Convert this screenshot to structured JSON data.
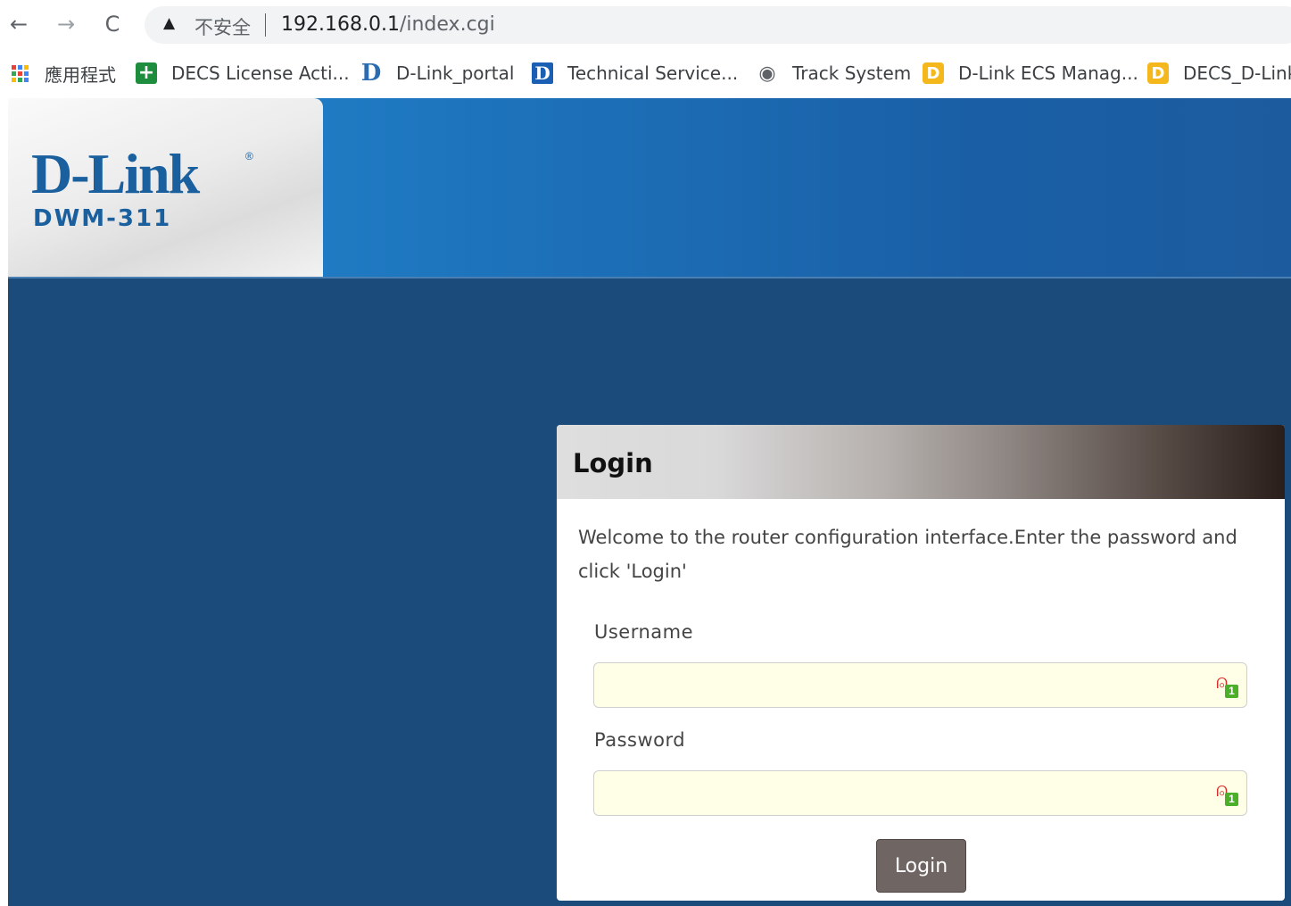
{
  "browser": {
    "nav": {
      "back": "←",
      "forward": "→",
      "reload": "C"
    },
    "security_warning_icon": "▲",
    "security_text": "不安全",
    "url_host": "192.168.0.1",
    "url_path": "/index.cgi"
  },
  "bookmarks": [
    {
      "icon": "apps-grid-icon",
      "label": "應用程式"
    },
    {
      "icon": "plus-icon",
      "label": "DECS License Acti..."
    },
    {
      "icon": "d-icon",
      "label": "D-Link_portal"
    },
    {
      "icon": "d-box-icon",
      "label": "Technical Service..."
    },
    {
      "icon": "globe-icon",
      "label": "Track System"
    },
    {
      "icon": "d-yellow-icon",
      "label": "D-Link ECS Manag..."
    },
    {
      "icon": "d-yellow-icon",
      "label": "DECS_D-Link"
    }
  ],
  "header": {
    "logo_text": "D-Link",
    "logo_registered": "®",
    "model": "DWM-311"
  },
  "login": {
    "title": "Login",
    "welcome": "Welcome to the router configuration interface.Enter the password and click 'Login'",
    "username_label": "Username",
    "password_label": "Password",
    "username_value": "",
    "password_value": "",
    "password_badge": "1",
    "button_label": "Login"
  },
  "colors": {
    "page_background": "#1b4b7a",
    "header_blue": "#2389d2",
    "brand_blue": "#1a5f9e",
    "field_background": "#ffffe8",
    "button": "#6f6562"
  }
}
